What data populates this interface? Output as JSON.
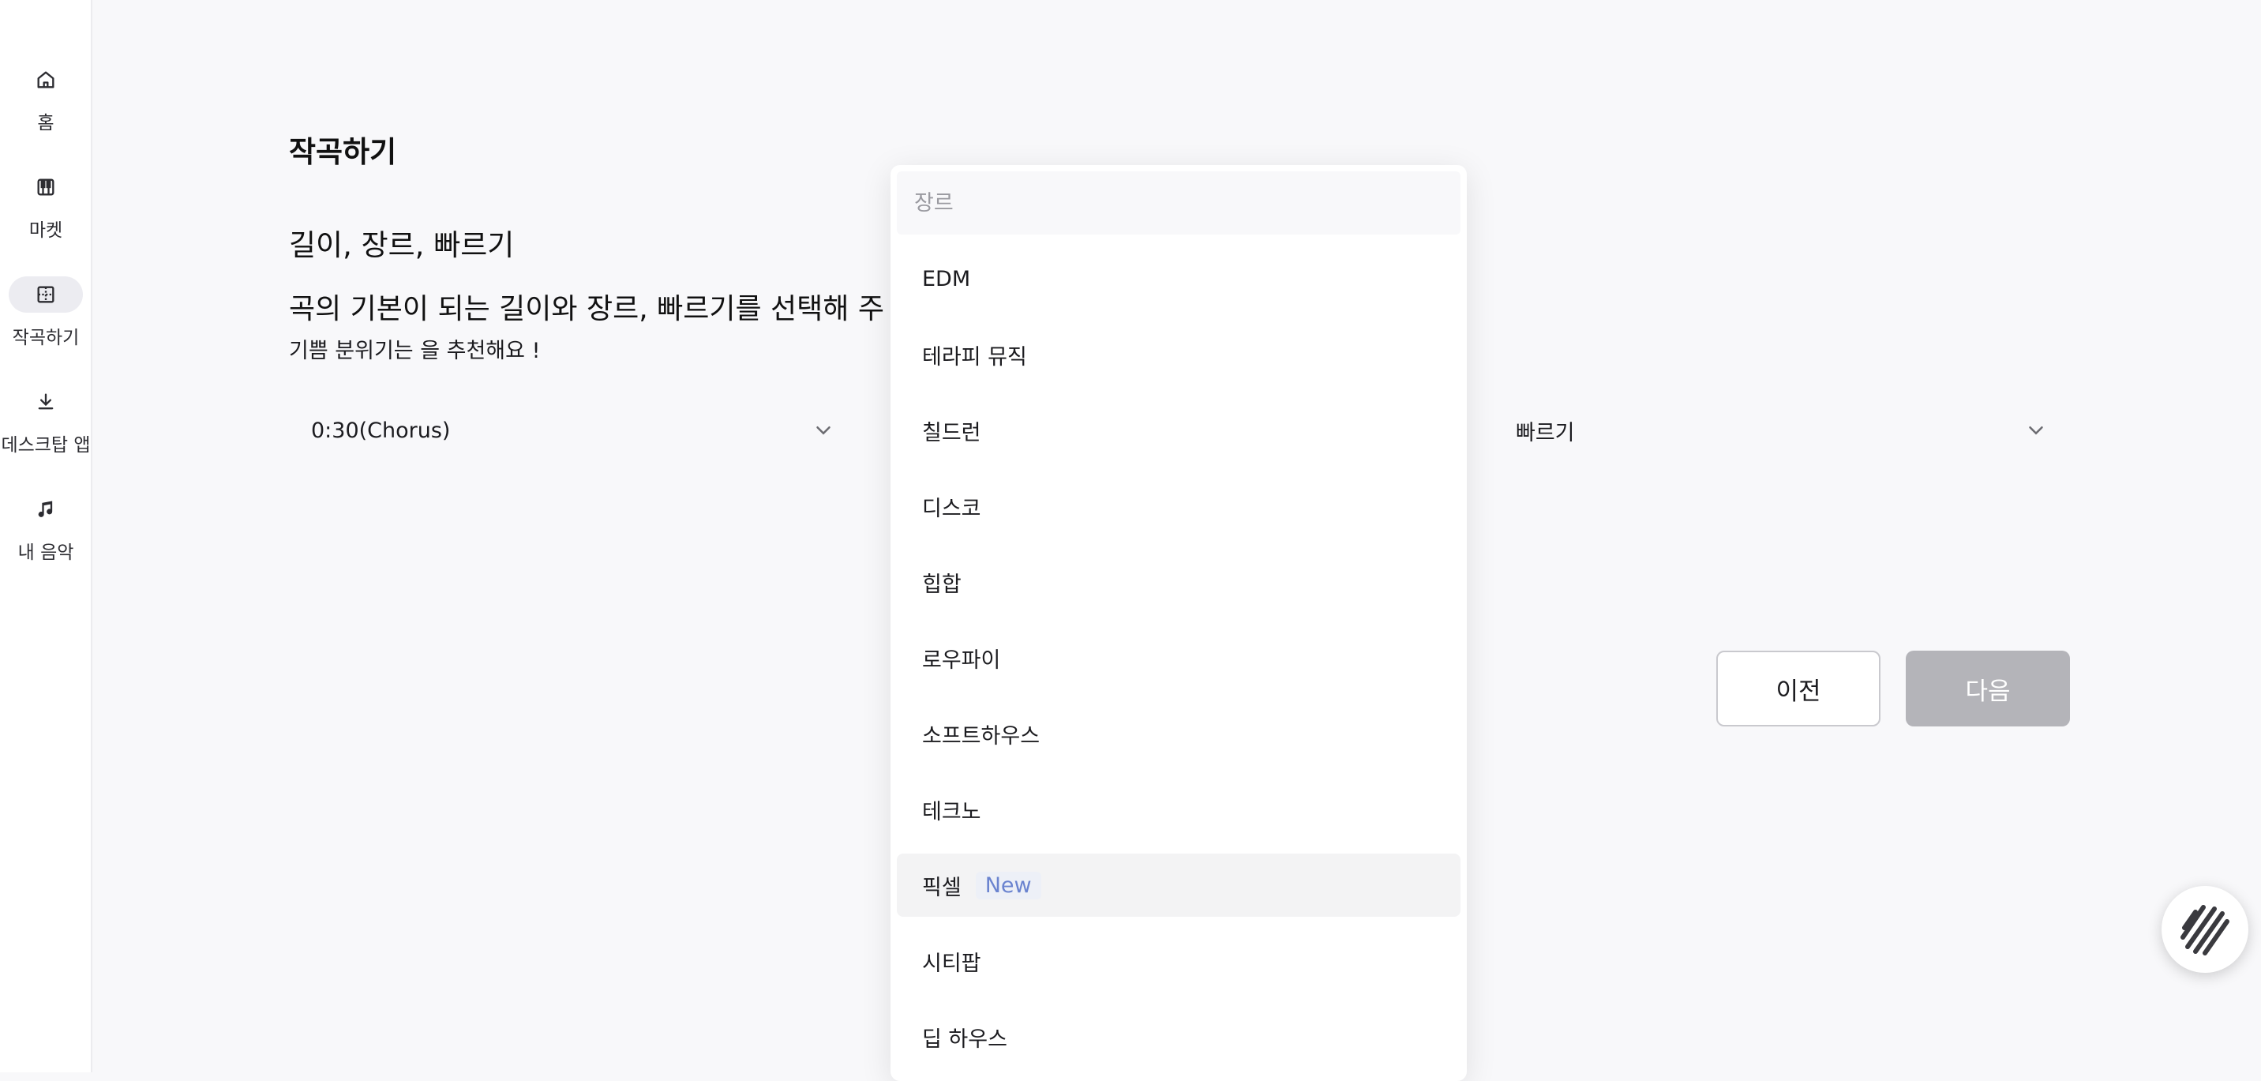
{
  "sidebar": {
    "items": [
      {
        "label": "홈",
        "icon": "home-icon"
      },
      {
        "label": "마켓",
        "icon": "piano-icon"
      },
      {
        "label": "작곡하기",
        "icon": "compose-grid-icon",
        "active": true
      },
      {
        "label": "데스크탑 앱",
        "icon": "download-icon"
      },
      {
        "label": "내 음악",
        "icon": "music-note-icon"
      }
    ]
  },
  "main": {
    "page_title": "작곡하기",
    "section_title": "길이, 장르, 빠르기",
    "section_desc": "곡의 기본이 되는 길이와 장르, 빠르기를 선택해 주",
    "section_hint": "기쁨 분위기는 을 추천해요 !",
    "length_select": {
      "value": "0:30(Chorus)"
    },
    "tempo_select": {
      "value": "빠르기"
    },
    "prev_button": "이전",
    "next_button": "다음"
  },
  "genre_dropdown": {
    "search_placeholder": "장르",
    "options": [
      {
        "label": "EDM"
      },
      {
        "label": "테라피 뮤직"
      },
      {
        "label": "칠드런"
      },
      {
        "label": "디스코"
      },
      {
        "label": "힙합"
      },
      {
        "label": "로우파이"
      },
      {
        "label": "소프트하우스"
      },
      {
        "label": "테크노"
      },
      {
        "label": "픽셀",
        "badge": "New"
      },
      {
        "label": "시티팝"
      },
      {
        "label": "딥 하우스"
      }
    ]
  },
  "colors": {
    "accent_badge": "#6a83cf",
    "disabled_button": "#b4b4b9",
    "background": "#f8f8fa"
  }
}
